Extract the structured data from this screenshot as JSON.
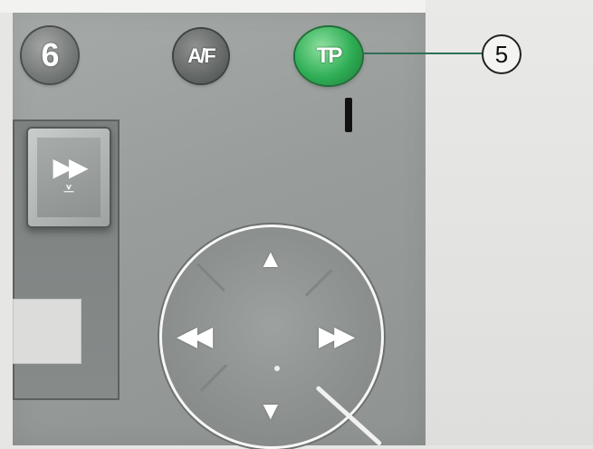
{
  "buttons": {
    "preset_6": "6",
    "af": "A/F",
    "tp": "TP"
  },
  "callout": {
    "number": "5"
  },
  "ffwd_panel": {
    "symbol_top": "▶▶",
    "symbol_bottom": "⩡"
  },
  "dial": {
    "up_symbol": "▲",
    "down_symbol": "▼",
    "left_symbol": "◀◀",
    "right_symbol": "▶▶"
  },
  "colors": {
    "tp_button": "#2fae55",
    "device_body": "#989c9a",
    "callout_line": "#2f6f55"
  },
  "icons": {
    "tp_button": "tp-icon",
    "up": "up-arrow-icon",
    "down": "down-arrow-icon",
    "rewind": "rewind-icon",
    "fast_forward": "fast-forward-icon"
  }
}
